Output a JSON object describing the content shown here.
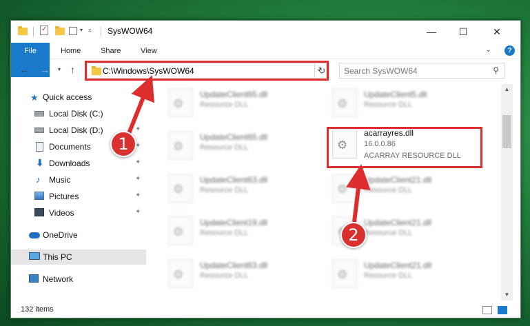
{
  "window": {
    "title": "SysWOW64",
    "controls": {
      "minimize": "—",
      "maximize": "☐",
      "close": "✕"
    }
  },
  "ribbon": {
    "tabs": [
      "File",
      "Home",
      "Share",
      "View"
    ],
    "collapse": "⌄",
    "help": "?"
  },
  "address": {
    "path": "C:\\Windows\\SysWOW64",
    "search_placeholder": "Search SysWOW64"
  },
  "sidebar": {
    "quick_access": "Quick access",
    "items": [
      {
        "label": "Local Disk (C:)"
      },
      {
        "label": "Local Disk (D:)"
      },
      {
        "label": "Documents"
      },
      {
        "label": "Downloads"
      },
      {
        "label": "Music"
      },
      {
        "label": "Pictures"
      },
      {
        "label": "Videos"
      }
    ],
    "onedrive": "OneDrive",
    "this_pc": "This PC",
    "network": "Network"
  },
  "files": {
    "left": [
      {
        "name": "UpdateClient65.dll",
        "type": "Resource DLL"
      },
      {
        "name": "UpdateClient65.dll",
        "type": "Resource DLL"
      },
      {
        "name": "UpdateClient63.dll",
        "type": "Resource DLL"
      },
      {
        "name": "UpdateClient19.dll",
        "type": "Resource DLL"
      },
      {
        "name": "UpdateClient63.dll",
        "type": "Resource DLL"
      }
    ],
    "right": [
      {
        "name": "UpdateClient5.dll",
        "type": "Resource DLL"
      },
      {
        "name": "UpdateClient21.dll",
        "type": "Resource DLL"
      },
      {
        "name": "UpdateClient21.dll",
        "type": "Resource DLL"
      },
      {
        "name": "UpdateClient21.dll",
        "type": "Resource DLL"
      }
    ],
    "highlighted": {
      "name": "acarrayres.dll",
      "version": "16.0.0.86",
      "description": "ACARRAY RESOURCE DLL"
    }
  },
  "status": {
    "items": "132 items"
  },
  "annotations": {
    "badge1": "1",
    "badge2": "2"
  },
  "colors": {
    "accent": "#1979ca",
    "annotation": "#dd2d2d"
  }
}
